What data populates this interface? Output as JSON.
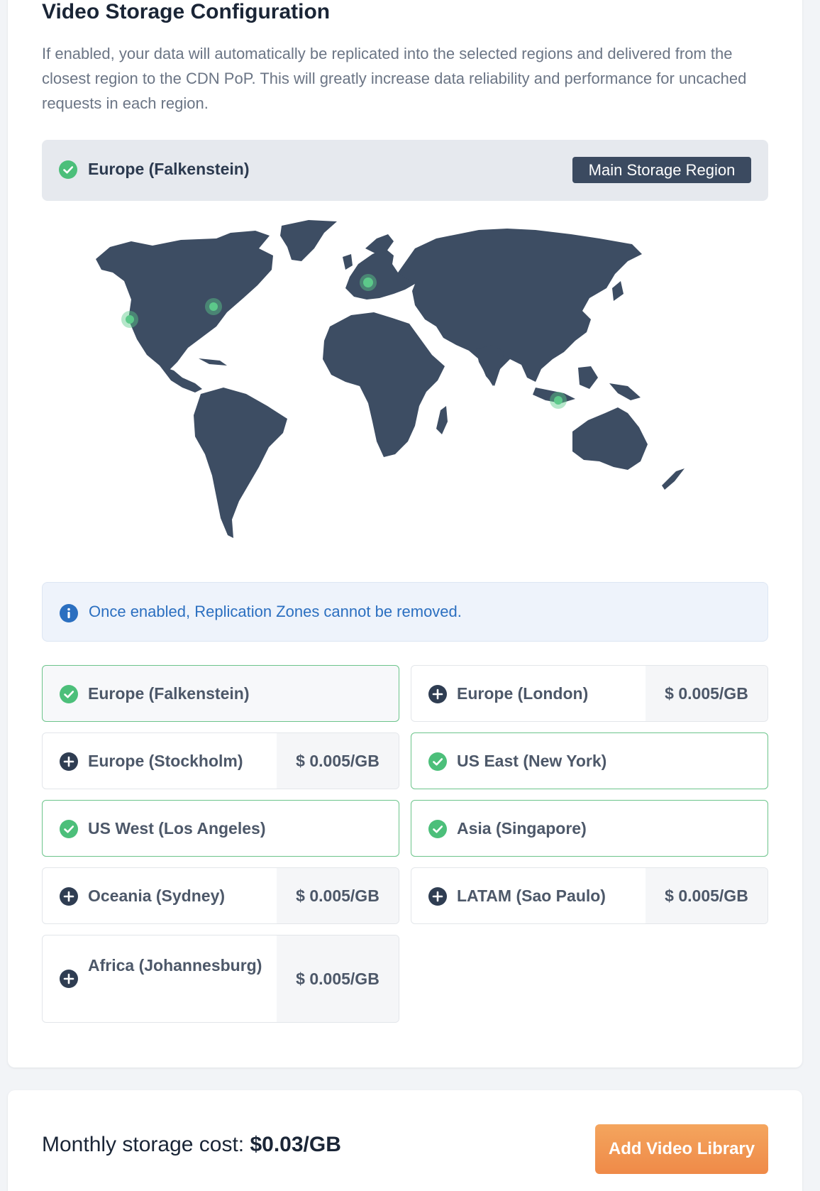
{
  "page": {
    "title": "Video Storage Configuration",
    "description": "If enabled, your data will automatically be replicated into the selected regions and delivered from the closest region to the CDN PoP. This will greatly increase data reliability and performance for uncached requests in each region."
  },
  "main_region": {
    "name": "Europe (Falkenstein)",
    "badge": "Main Storage Region"
  },
  "map": {
    "land_color": "#3d4d63",
    "marker_color": "#5cc98a",
    "markers": [
      "Europe (Falkenstein)",
      "US East (New York)",
      "US West (Los Angeles)",
      "Asia (Singapore)"
    ]
  },
  "notice": {
    "text": "Once enabled, Replication Zones cannot be removed."
  },
  "regions": [
    {
      "name": "Europe (Falkenstein)",
      "selected": true,
      "price": ""
    },
    {
      "name": "Europe (London)",
      "selected": false,
      "price": "$ 0.005/GB"
    },
    {
      "name": "Europe (Stockholm)",
      "selected": false,
      "price": "$ 0.005/GB"
    },
    {
      "name": "US East (New York)",
      "selected": true,
      "price": ""
    },
    {
      "name": "US West (Los Angeles)",
      "selected": true,
      "price": ""
    },
    {
      "name": "Asia (Singapore)",
      "selected": true,
      "price": ""
    },
    {
      "name": "Oceania (Sydney)",
      "selected": false,
      "price": "$ 0.005/GB"
    },
    {
      "name": "LATAM (Sao Paulo)",
      "selected": false,
      "price": "$ 0.005/GB"
    },
    {
      "name": "Africa (Johannesburg)",
      "selected": false,
      "price": "$ 0.005/GB"
    }
  ],
  "footer": {
    "cost_label": "Monthly storage cost:",
    "cost_value": "$0.03/GB",
    "button_label": "Add Video Library"
  },
  "colors": {
    "selected_border": "#6cc48b",
    "check_green": "#4cbf7a",
    "plus_dark": "#2f3d52",
    "badge_bg": "#3b4a60",
    "info_blue": "#2b6fc0",
    "button_orange": "#f09250"
  }
}
